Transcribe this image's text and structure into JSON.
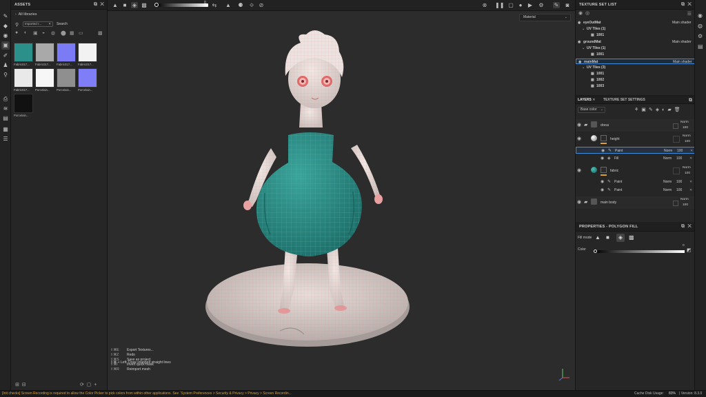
{
  "assets": {
    "title": "ASSETS",
    "breadcrumb": "All libraries",
    "filter_chip": "Imported r...",
    "search_label": "Search",
    "items": [
      {
        "label": "Fabric017...",
        "color": "#2b8f8a"
      },
      {
        "label": "Fabric017...",
        "color": "#a9a9a9"
      },
      {
        "label": "Fabric017...",
        "color": "#7b7cf5"
      },
      {
        "label": "Fabric017...",
        "color": "#f2f2f2"
      },
      {
        "label": "Fabric017...",
        "color": "#e9e9e9"
      },
      {
        "label": "Porcelain...",
        "color": "#f7f7f7"
      },
      {
        "label": "Porcelain...",
        "color": "#8f8f8f"
      },
      {
        "label": "Porcelain...",
        "color": "#7f7ef7"
      },
      {
        "label": "Porcelain...",
        "color": "#111111"
      }
    ]
  },
  "viewport": {
    "slider_value": "0",
    "dropdown": "Material",
    "shortcuts": [
      {
        "keys": "⇧⌘E",
        "label": "Export Textures..."
      },
      {
        "keys": "⇧⌘Z",
        "label": "Redo"
      },
      {
        "keys": "⇧⌘S",
        "label": "Save as project"
      },
      {
        "keys": "⇧⌘I",
        "label": "Invert quick mask"
      },
      {
        "keys": "⇧⌘R",
        "label": "Reimport mesh"
      }
    ],
    "hint": "⇧⌘ + Left: Draw snapped straight lines"
  },
  "texture_set_list": {
    "title": "TEXTURE SET LIST",
    "sets": [
      {
        "name": "eyeOutMat",
        "shader": "Main shader",
        "uv_label": "UV Tiles (1)",
        "tiles": [
          "1001"
        ]
      },
      {
        "name": "groundMat",
        "shader": "Main shader",
        "uv_label": "UV Tiles (1)",
        "tiles": [
          "1001"
        ]
      },
      {
        "name": "mainMat",
        "shader": "Main shader",
        "uv_label": "UV Tiles (3)",
        "tiles": [
          "1001",
          "1002",
          "1003"
        ]
      }
    ]
  },
  "layers": {
    "tab_layers": "LAYERS",
    "tab_settings": "TEXTURE SET SETTINGS",
    "channel": "Base color",
    "rows": {
      "dress": {
        "name": "dress",
        "blend": "Norm",
        "opacity": "100"
      },
      "height": {
        "name": "height",
        "blend": "Norm",
        "opacity": "100"
      },
      "height_paint": {
        "name": "Paint",
        "blend": "Norm",
        "opacity": "100"
      },
      "height_fill": {
        "name": "Fill",
        "blend": "Norm",
        "opacity": "100"
      },
      "fabric": {
        "name": "fabric",
        "blend": "Norm",
        "opacity": "100"
      },
      "fabric_paint1": {
        "name": "Paint",
        "blend": "Norm",
        "opacity": "100"
      },
      "fabric_paint2": {
        "name": "Paint",
        "blend": "Norm",
        "opacity": "100"
      },
      "main_body": {
        "name": "main body",
        "blend": "Norm",
        "opacity": "100"
      }
    }
  },
  "properties": {
    "title": "PROPERTIES - POLYGON FILL",
    "fill_mode_label": "Fill mode",
    "color_label": "Color",
    "color_value": "0"
  },
  "status": {
    "message": "[Init checks] Screen Recording is required to allow the Color Picker to pick colors from within other applications. See `System Preferences > Security & Privacy > Privacy > Screen Recordin...",
    "cache_label": "Cache Disk Usage:",
    "cache_value": "83%",
    "version": "| Version: 8.3.0"
  },
  "colors": {
    "accent": "#3d8ee0",
    "teal": "#2b8f8a",
    "warning": "#e0a030"
  }
}
